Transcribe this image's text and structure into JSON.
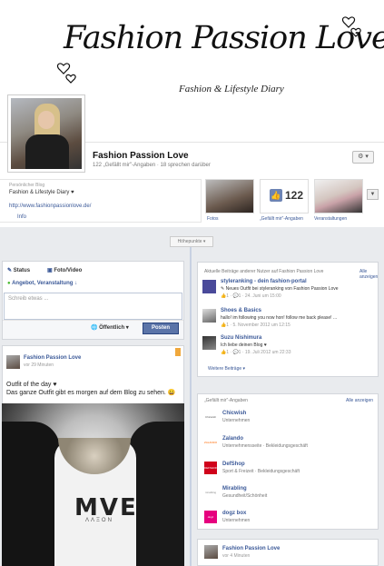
{
  "cover": {
    "title": "Fashion Passion Love",
    "subtitle": "Fashion & Lifestyle Diary"
  },
  "page": {
    "name": "Fashion Passion Love",
    "meta": "122 „Gefällt mir\"-Angaben · 18 sprechen darüber"
  },
  "info": {
    "category_label": "Persönlicher Blog",
    "category": "Fashion & Lifestyle Diary ♥",
    "url": "http://www.fashionpassionlove.de/",
    "label": "Info"
  },
  "apps": {
    "photos_label": "Fotos",
    "likes_count": "122",
    "likes_label": "„Gefällt mir\"-Angaben",
    "events_label": "Veranstaltungen"
  },
  "timeline": {
    "highlights": "Höhepunkte ▾"
  },
  "composer": {
    "tab_status": "Status",
    "tab_photo": "Foto/Video",
    "sub": "Angebot, Veranstaltung ↓",
    "placeholder": "Schreib etwas ...",
    "privacy": "Öffentlich ▾",
    "post_button": "Posten"
  },
  "post": {
    "author": "Fashion Passion Love",
    "time": "vor 29 Minuten",
    "line1": "Outfit of the day ♥",
    "line2": "Das ganze Outfit gibt es morgen auf dem Blog zu sehen. 😀",
    "print": "MVE",
    "print2": "ΛΛΞΟΝ"
  },
  "recent": {
    "title": "Aktuelle Beiträge anderer Nutzer auf Fashion Passion Love",
    "all": "Alle anzeigen",
    "items": [
      {
        "name": "styleranking - dein fashion-portal",
        "text": "✎ Neues Outfit bei styleranking von Fashion Passion Love",
        "meta": "👍1 · 💬1 · 24. Juni um 15:00"
      },
      {
        "name": "Shoes & Basics",
        "text": "hallo! im following you now hon! follow me back please! ...",
        "meta": "👍1 · 5. November 2012 um 12:15"
      },
      {
        "name": "Suzu Nishimura",
        "text": "Ich liebe deinen Blog ♥",
        "meta": "👍1 · 💬1 · 19. Juli 2012 um 22:33"
      }
    ],
    "more": "Weitere Beiträge ▾"
  },
  "likes": {
    "title": "„Gefällt mir\"-Angaben",
    "all": "Alle anzeigen",
    "items": [
      {
        "logo": "Chicwish",
        "name": "Chicwish",
        "cat": "Unternehmen",
        "color": "#ffffff",
        "fg": "#555555"
      },
      {
        "logo": "ZALANDO",
        "name": "Zalando",
        "cat": "Unternehmensseite · Bekleidungsgeschäft",
        "color": "#ffffff",
        "fg": "#ff6900"
      },
      {
        "logo": "DEFSHOP",
        "name": "DefShop",
        "cat": "Sport & Freizeit · Bekleidungsgeschäft",
        "color": "#d0021b",
        "fg": "#ffffff"
      },
      {
        "logo": "mirabling",
        "name": "Mirabling",
        "cat": "Gesundheit/Schönheit",
        "color": "#ffffff",
        "fg": "#888888"
      },
      {
        "logo": "dogz",
        "name": "dogz box",
        "cat": "Unternehmen",
        "color": "#e6007e",
        "fg": "#ffffff"
      }
    ]
  },
  "bottom_post": {
    "author": "Fashion Passion Love",
    "time": "vor 4 Minuten"
  }
}
